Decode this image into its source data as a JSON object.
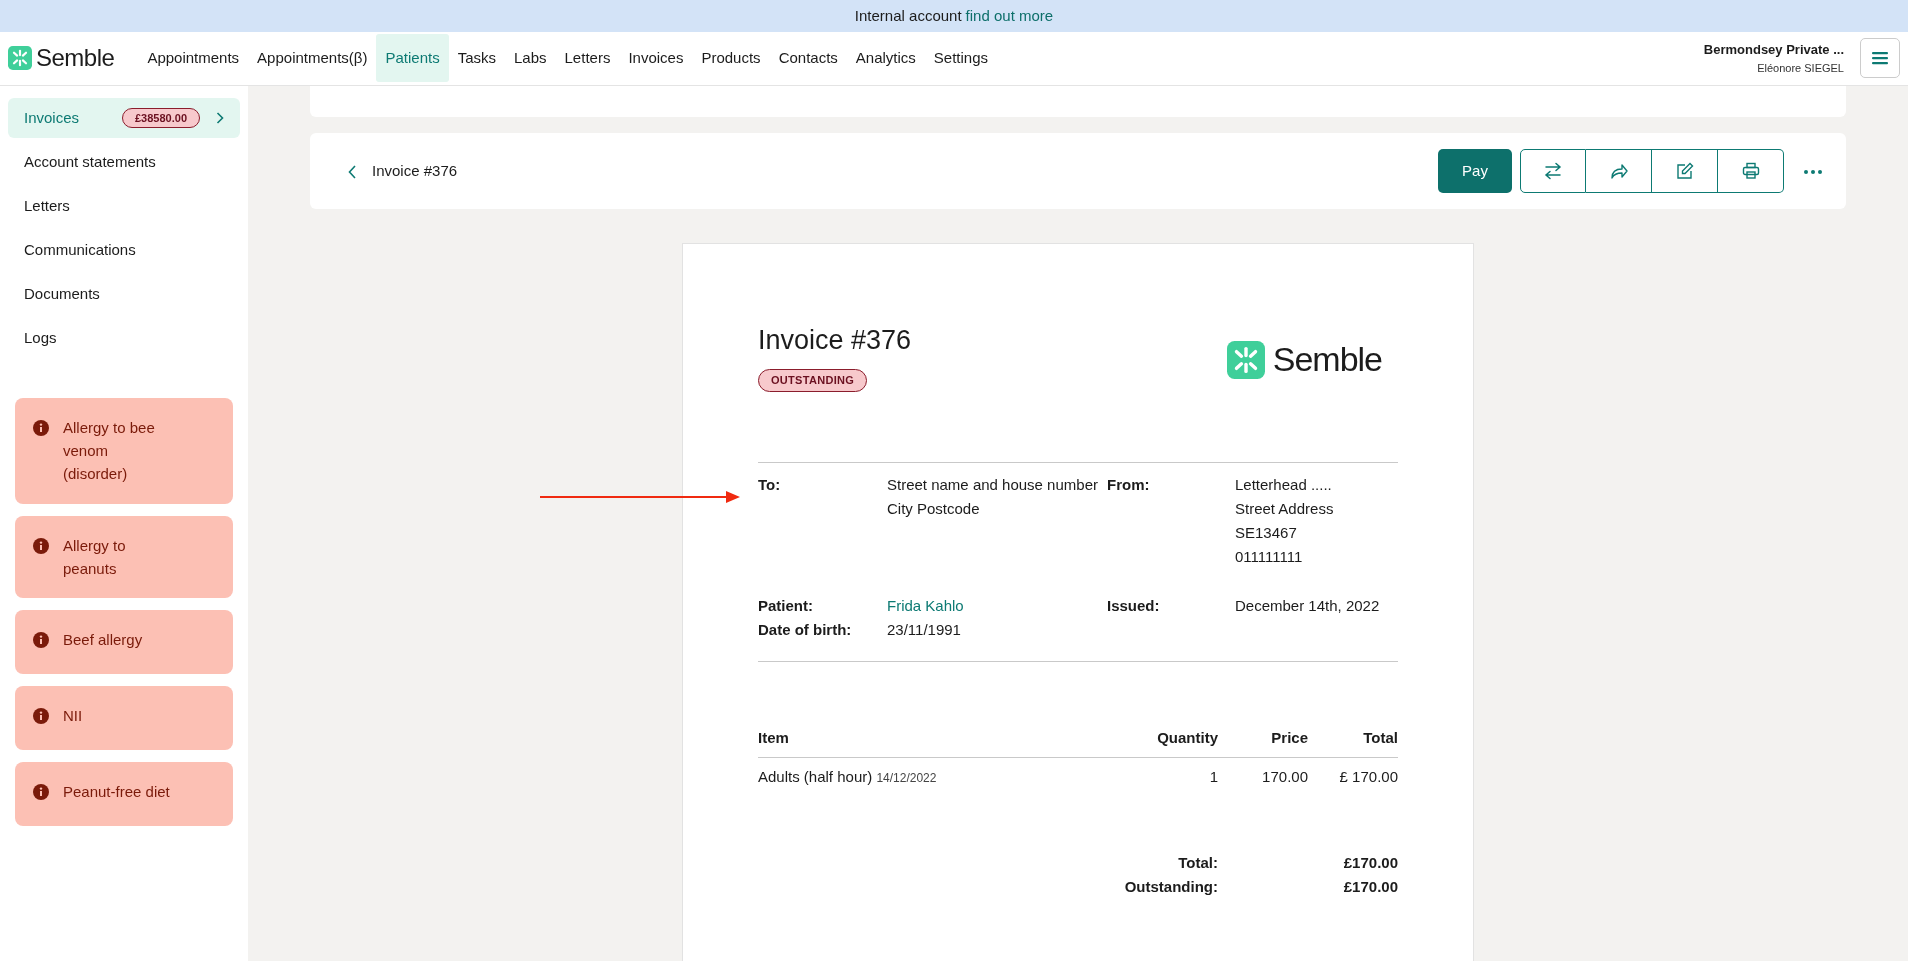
{
  "banner": {
    "text": "Internal account",
    "link": "find out more"
  },
  "navbar": {
    "brand": "Semble",
    "items": [
      {
        "label": "Appointments",
        "selected": false
      },
      {
        "label": "Appointments(β)",
        "selected": false
      },
      {
        "label": "Patients",
        "selected": true
      },
      {
        "label": "Tasks",
        "selected": false
      },
      {
        "label": "Labs",
        "selected": false
      },
      {
        "label": "Letters",
        "selected": false
      },
      {
        "label": "Invoices",
        "selected": false
      },
      {
        "label": "Products",
        "selected": false
      },
      {
        "label": "Contacts",
        "selected": false
      },
      {
        "label": "Analytics",
        "selected": false
      },
      {
        "label": "Settings",
        "selected": false
      }
    ],
    "account": {
      "organisation": "Bermondsey Private ...",
      "user": "Eléonore SIEGEL"
    }
  },
  "sidebar": {
    "items": [
      {
        "label": "Invoices",
        "selected": true,
        "badge": "£38580.00"
      },
      {
        "label": "Account statements",
        "selected": false
      },
      {
        "label": "Letters",
        "selected": false
      },
      {
        "label": "Communications",
        "selected": false
      },
      {
        "label": "Documents",
        "selected": false
      },
      {
        "label": "Logs",
        "selected": false
      }
    ],
    "alerts": [
      {
        "text": "Allergy to bee venom (disorder)"
      },
      {
        "text": "Allergy to peanuts"
      },
      {
        "text": "Beef allergy"
      },
      {
        "text": "NII"
      },
      {
        "text": "Peanut-free diet"
      }
    ]
  },
  "toolbar": {
    "title": "Invoice #376",
    "pay": "Pay"
  },
  "invoice": {
    "title": "Invoice #376",
    "status": "OUTSTANDING",
    "logo": "Semble",
    "to": {
      "label": "To:",
      "lines": [
        "Street name and house number",
        "City Postcode"
      ]
    },
    "from": {
      "label": "From:",
      "lines": [
        "Letterhead .....",
        "Street Address",
        "SE13467",
        "011111111"
      ]
    },
    "patient": {
      "label": "Patient:",
      "value": "Frida Kahlo"
    },
    "dob": {
      "label": "Date of birth:",
      "value": "23/11/1991"
    },
    "issued": {
      "label": "Issued:",
      "value": "December 14th, 2022"
    },
    "table": {
      "columns": [
        "Item",
        "Quantity",
        "Price",
        "Total"
      ],
      "rows": [
        {
          "item": "Adults (half hour)",
          "date": "14/12/2022",
          "quantity": "1",
          "price": "170.00",
          "total": "£ 170.00"
        }
      ]
    },
    "totals": [
      {
        "label": "Total:",
        "value": "£170.00"
      },
      {
        "label": "Outstanding:",
        "value": "£170.00"
      }
    ]
  }
}
